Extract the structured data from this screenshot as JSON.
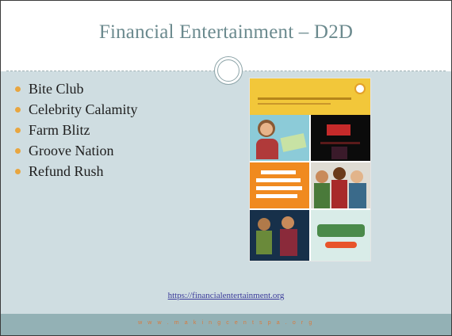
{
  "slide": {
    "title": "Financial Entertainment – D2D",
    "bullets": [
      "Bite Club",
      "Celebrity Calamity",
      "Farm Blitz",
      "Groove Nation",
      "Refund Rush"
    ],
    "link": "https://financialentertainment.org",
    "footer": "w w w . m a k i n g c e n t s p a . o r g"
  },
  "cover_image": {
    "header_text": "CAN GAMES BUILD FINANCIAL CAPABILITY?",
    "tile_texts": [
      "BITE",
      "Can Games Build Financial Capability?",
      "REFUND"
    ]
  },
  "colors": {
    "title": "#6b8a8e",
    "background": "#cfdde1",
    "bullet": "#e8a640",
    "footer_band": "#93b1b5",
    "footer_text": "#d97a3d",
    "link": "#3a3a9a"
  }
}
